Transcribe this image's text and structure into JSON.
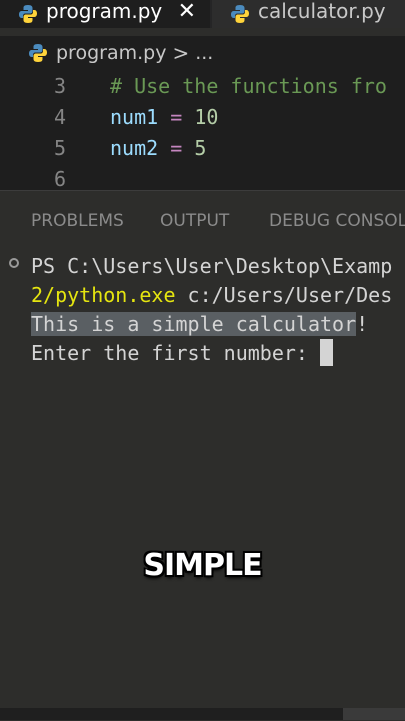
{
  "tabs": [
    {
      "label": "program.py",
      "active": true,
      "close": "✕"
    },
    {
      "label": "calculator.py",
      "active": false
    }
  ],
  "breadcrumb": {
    "file": "program.py",
    "separator": ">",
    "rest": "..."
  },
  "editor": {
    "lines": [
      {
        "number": "3",
        "comment": "# Use the functions fro"
      },
      {
        "number": "4",
        "var": "num1",
        "op": "=",
        "value": "10"
      },
      {
        "number": "5",
        "var": "num2",
        "op": "=",
        "value": "5"
      },
      {
        "number": "6"
      }
    ]
  },
  "panel": {
    "tabs": [
      "PROBLEMS",
      "OUTPUT",
      "DEBUG CONSOLE"
    ]
  },
  "terminal": {
    "line1": "PS C:\\Users\\User\\Desktop\\Examp",
    "line2_path": "2/python.exe",
    "line2_rest": " c:/Users/User/Des",
    "line3_highlight": "This is a simple calculator",
    "line3_rest": "!",
    "line4": "Enter the first number:"
  },
  "caption": "SIMPLE",
  "colors": {
    "editor_bg": "#1e1e1e",
    "panel_bg": "#2d2d2b",
    "yellow": "#e5e510",
    "number": "#b5cea8",
    "operator": "#c586c0"
  }
}
